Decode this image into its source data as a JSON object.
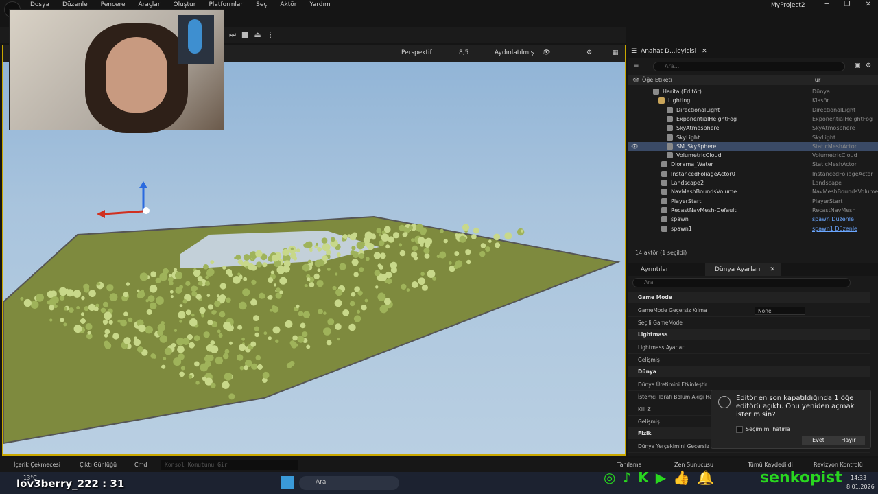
{
  "menu": [
    "Dosya",
    "Düzenle",
    "Pencere",
    "Araçlar",
    "Oluştur",
    "Platformlar",
    "Seç",
    "Aktör",
    "Yardım"
  ],
  "project_title": "MyProject2",
  "viewport": {
    "perspective": "Perspektif",
    "speed": "8,5",
    "lit": "Aydınlatılmış"
  },
  "outliner": {
    "tab": "Anahat D...leyicisi",
    "search_placeholder": "Ara...",
    "col_label": "Öğe Etiketi",
    "col_type": "Tür",
    "rows": [
      {
        "name": "Harita (Editör)",
        "type": "Dünya"
      },
      {
        "name": "Lighting",
        "type": "Klasör"
      },
      {
        "name": "DirectionalLight",
        "type": "DirectionalLight"
      },
      {
        "name": "ExponentialHeightFog",
        "type": "ExponentialHeightFog"
      },
      {
        "name": "SkyAtmosphere",
        "type": "SkyAtmosphere"
      },
      {
        "name": "SkyLight",
        "type": "SkyLight"
      },
      {
        "name": "SM_SkySphere",
        "type": "StaticMeshActor"
      },
      {
        "name": "VolumetricCloud",
        "type": "VolumetricCloud"
      },
      {
        "name": "Diorama_Water",
        "type": "StaticMeshActor"
      },
      {
        "name": "InstancedFoliageActor0",
        "type": "InstancedFoliageActor"
      },
      {
        "name": "Landscape2",
        "type": "Landscape"
      },
      {
        "name": "NavMeshBoundsVolume",
        "type": "NavMeshBoundsVolume"
      },
      {
        "name": "PlayerStart",
        "type": "PlayerStart"
      },
      {
        "name": "RecastNavMesh-Default",
        "type": "RecastNavMesh"
      },
      {
        "name": "spawn",
        "type": "spawn Düzenle"
      },
      {
        "name": "spawn1",
        "type": "spawn1 Düzenle"
      }
    ],
    "count": "14 aktör (1 seçildi)"
  },
  "details": {
    "tab1": "Ayrıntılar",
    "tab2": "Dünya Ayarları",
    "search_placeholder": "Ara",
    "items": [
      {
        "kind": "sect",
        "label": "Game Mode"
      },
      {
        "kind": "prop",
        "label": "GameMode Geçersiz Kılma",
        "value": "None"
      },
      {
        "kind": "prop",
        "label": "Seçili GameMode"
      },
      {
        "kind": "sect",
        "label": "Lightmass"
      },
      {
        "kind": "prop",
        "label": "Lightmass Ayarları"
      },
      {
        "kind": "prop",
        "label": "Gelişmiş"
      },
      {
        "kind": "sect",
        "label": "Dünya"
      },
      {
        "kind": "prop",
        "label": "Dünya Üretimini Etkinleştir"
      },
      {
        "kind": "prop",
        "label": "İstemci Tarafı Bölüm Akışı Hac"
      },
      {
        "kind": "prop",
        "label": "Kill Z"
      },
      {
        "kind": "prop",
        "label": "Gelişmiş"
      },
      {
        "kind": "sect",
        "label": "Fizik"
      },
      {
        "kind": "prop",
        "label": "Dünya Yerçekimini Geçersiz Kıl"
      }
    ]
  },
  "notification": {
    "message": "Editör en son kapatıldığında 1 öğe editörü açıktı. Onu yeniden açmak ister misin?",
    "remember": "Seçimimi hatırla",
    "yes": "Evet",
    "no": "Hayır"
  },
  "statusbar": {
    "content": "İçerik Çekmecesi",
    "log": "Çıktı Günlüğü",
    "cmd": "Cmd",
    "console_placeholder": "Konsol Komutunu Gir",
    "trace": "Tanılama",
    "zen": "Zen Sunucusu",
    "saveall": "Tümü Kaydedildi",
    "revision": "Revizyon Kontrolü"
  },
  "taskbar": {
    "weather": "13°C",
    "search": "Ara",
    "time": "14:33",
    "date": "8.01.2026"
  },
  "stream_overlay": {
    "username": "lov3berry_222 : 31",
    "channel": "senkopist"
  }
}
